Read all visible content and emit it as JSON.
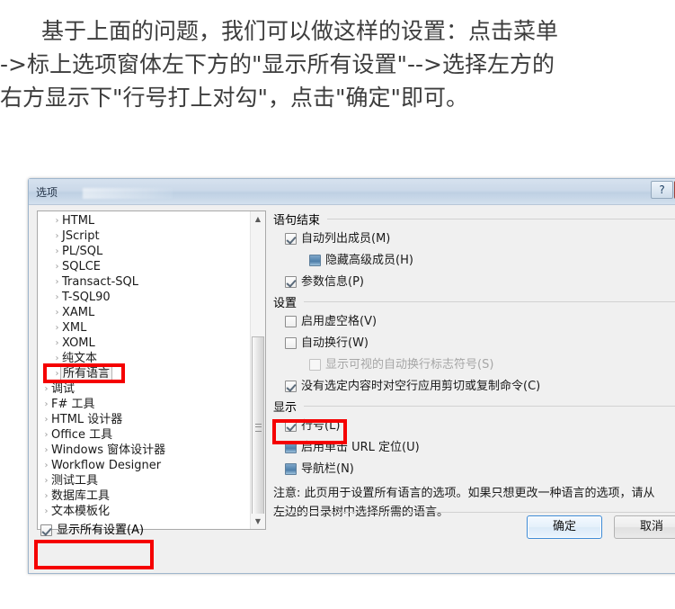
{
  "article": {
    "lines": [
      "基于上面的问题，我们可以做这样的设置：点击菜单",
      "->标上选项窗体左下方的\"显示所有设置\"-->选择左方的",
      "右方显示下\"行号打上对勾\"，点击\"确定\"即可。"
    ]
  },
  "dialog": {
    "title": "选项",
    "help_label": "?",
    "close_label": "✕",
    "tree": {
      "items": [
        {
          "label": "HTML",
          "level": 1,
          "arrow": "›",
          "selected": false
        },
        {
          "label": "JScript",
          "level": 1,
          "arrow": "›",
          "selected": false
        },
        {
          "label": "PL/SQL",
          "level": 1,
          "arrow": "›",
          "selected": false
        },
        {
          "label": "SQLCE",
          "level": 1,
          "arrow": "›",
          "selected": false
        },
        {
          "label": "Transact-SQL",
          "level": 1,
          "arrow": "›",
          "selected": false
        },
        {
          "label": "T-SQL90",
          "level": 1,
          "arrow": "›",
          "selected": false
        },
        {
          "label": "XAML",
          "level": 1,
          "arrow": "›",
          "selected": false
        },
        {
          "label": "XML",
          "level": 1,
          "arrow": "›",
          "selected": false
        },
        {
          "label": "XOML",
          "level": 1,
          "arrow": "›",
          "selected": false
        },
        {
          "label": "纯文本",
          "level": 1,
          "arrow": "›",
          "selected": false
        },
        {
          "label": "所有语言",
          "level": 1,
          "arrow": "›",
          "selected": true
        },
        {
          "label": "调试",
          "level": 0,
          "arrow": "›",
          "selected": false
        },
        {
          "label": "F# 工具",
          "level": 0,
          "arrow": "›",
          "selected": false
        },
        {
          "label": "HTML 设计器",
          "level": 0,
          "arrow": "›",
          "selected": false
        },
        {
          "label": "Office 工具",
          "level": 0,
          "arrow": "›",
          "selected": false
        },
        {
          "label": "Windows 窗体设计器",
          "level": 0,
          "arrow": "›",
          "selected": false
        },
        {
          "label": "Workflow Designer",
          "level": 0,
          "arrow": "›",
          "selected": false
        },
        {
          "label": "测试工具",
          "level": 0,
          "arrow": "›",
          "selected": false
        },
        {
          "label": "数据库工具",
          "level": 0,
          "arrow": "›",
          "selected": false
        },
        {
          "label": "文本模板化",
          "level": 0,
          "arrow": "›",
          "selected": false
        }
      ],
      "scroll_up_glyph": "▲",
      "scroll_down_glyph": "▼"
    },
    "groups": [
      {
        "title": "语句结束",
        "options": [
          {
            "label": "自动列出成员(M)",
            "state": "checked",
            "indent": 1,
            "disabled": false
          },
          {
            "label": "隐藏高级成员(H)",
            "state": "filled",
            "indent": 2,
            "disabled": false
          },
          {
            "label": "参数信息(P)",
            "state": "checked",
            "indent": 1,
            "disabled": false
          }
        ]
      },
      {
        "title": "设置",
        "options": [
          {
            "label": "启用虚空格(V)",
            "state": "unchecked",
            "indent": 1,
            "disabled": false
          },
          {
            "label": "自动换行(W)",
            "state": "unchecked",
            "indent": 1,
            "disabled": false
          },
          {
            "label": "显示可视的自动换行标志符号(S)",
            "state": "unchecked",
            "indent": 2,
            "disabled": true
          },
          {
            "label": "没有选定内容时对空行应用剪切或复制命令(C)",
            "state": "checked",
            "indent": 1,
            "disabled": false
          }
        ]
      },
      {
        "title": "显示",
        "options": [
          {
            "label": "行号(L)",
            "state": "checked",
            "indent": 1,
            "disabled": false
          },
          {
            "label": "启用单击 URL 定位(U)",
            "state": "filled",
            "indent": 1,
            "disabled": false
          },
          {
            "label": "导航栏(N)",
            "state": "filled",
            "indent": 1,
            "disabled": false
          }
        ]
      }
    ],
    "note": "注意: 此页用于设置所有语言的选项。如果只想更改一种语言的选项，请从左边的目录树中选择所需的语言。",
    "show_all_settings": {
      "label": "显示所有设置(A)",
      "state": "checked"
    },
    "ok_label": "确定",
    "cancel_label": "取消"
  },
  "annotations": {
    "color": "#f50000",
    "boxes": [
      "all-languages",
      "line-numbers",
      "show-all-settings"
    ]
  }
}
